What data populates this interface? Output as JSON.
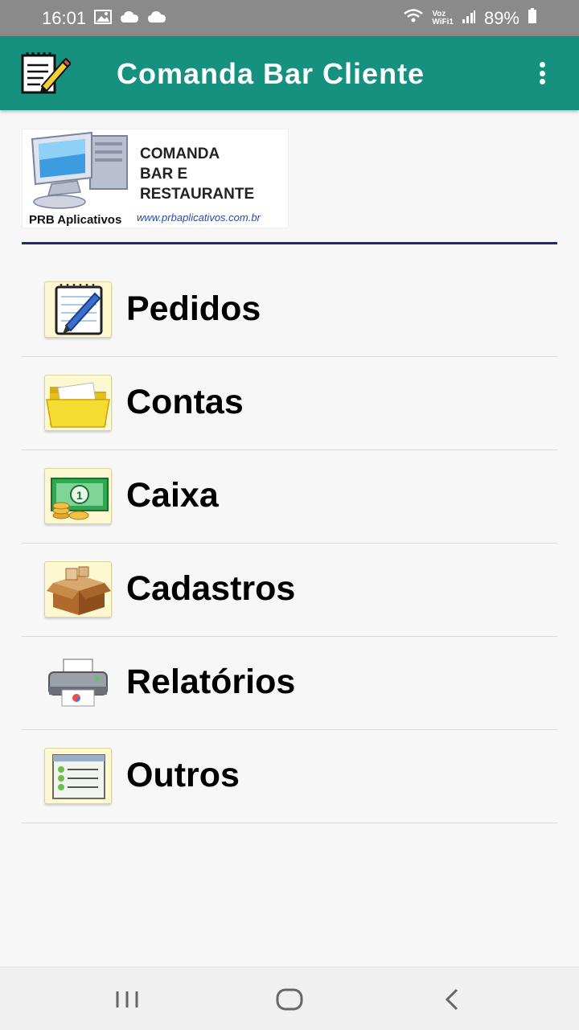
{
  "status_bar": {
    "time": "16:01",
    "battery_percent": "89%",
    "wifi_label_top": "Voz",
    "wifi_label_bottom": "WiFi1",
    "icons": [
      "gallery-icon",
      "cloud-icon",
      "cloud-icon",
      "wifi-icon",
      "signal-icon",
      "battery-icon"
    ]
  },
  "app_bar": {
    "title": "Comanda Bar Cliente",
    "icon": "notepad-pencil-icon",
    "menu_icon": "more-vert-icon",
    "color": "#17917f"
  },
  "banner": {
    "line1": "COMANDA",
    "line2": "BAR E",
    "line3": "RESTAURANTE",
    "brand": "PRB Aplicativos",
    "url": "www.prbaplicativos.com.br"
  },
  "menu": {
    "items": [
      {
        "label": "Pedidos",
        "icon": "notepad-icon"
      },
      {
        "label": "Contas",
        "icon": "folder-icon"
      },
      {
        "label": "Caixa",
        "icon": "money-icon"
      },
      {
        "label": "Cadastros",
        "icon": "box-icon"
      },
      {
        "label": "Relatórios",
        "icon": "printer-icon"
      },
      {
        "label": "Outros",
        "icon": "list-icon"
      }
    ]
  },
  "nav_bar": {
    "icons": [
      "recents-icon",
      "home-icon",
      "back-icon"
    ]
  }
}
